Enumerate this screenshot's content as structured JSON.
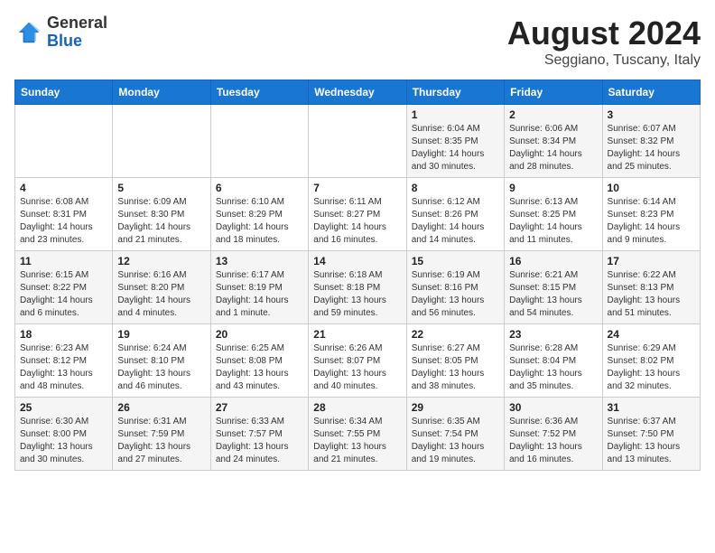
{
  "logo": {
    "general": "General",
    "blue": "Blue"
  },
  "header": {
    "month_year": "August 2024",
    "location": "Seggiano, Tuscany, Italy"
  },
  "weekdays": [
    "Sunday",
    "Monday",
    "Tuesday",
    "Wednesday",
    "Thursday",
    "Friday",
    "Saturday"
  ],
  "weeks": [
    [
      {
        "day": "",
        "info": ""
      },
      {
        "day": "",
        "info": ""
      },
      {
        "day": "",
        "info": ""
      },
      {
        "day": "",
        "info": ""
      },
      {
        "day": "1",
        "info": "Sunrise: 6:04 AM\nSunset: 8:35 PM\nDaylight: 14 hours\nand 30 minutes."
      },
      {
        "day": "2",
        "info": "Sunrise: 6:06 AM\nSunset: 8:34 PM\nDaylight: 14 hours\nand 28 minutes."
      },
      {
        "day": "3",
        "info": "Sunrise: 6:07 AM\nSunset: 8:32 PM\nDaylight: 14 hours\nand 25 minutes."
      }
    ],
    [
      {
        "day": "4",
        "info": "Sunrise: 6:08 AM\nSunset: 8:31 PM\nDaylight: 14 hours\nand 23 minutes."
      },
      {
        "day": "5",
        "info": "Sunrise: 6:09 AM\nSunset: 8:30 PM\nDaylight: 14 hours\nand 21 minutes."
      },
      {
        "day": "6",
        "info": "Sunrise: 6:10 AM\nSunset: 8:29 PM\nDaylight: 14 hours\nand 18 minutes."
      },
      {
        "day": "7",
        "info": "Sunrise: 6:11 AM\nSunset: 8:27 PM\nDaylight: 14 hours\nand 16 minutes."
      },
      {
        "day": "8",
        "info": "Sunrise: 6:12 AM\nSunset: 8:26 PM\nDaylight: 14 hours\nand 14 minutes."
      },
      {
        "day": "9",
        "info": "Sunrise: 6:13 AM\nSunset: 8:25 PM\nDaylight: 14 hours\nand 11 minutes."
      },
      {
        "day": "10",
        "info": "Sunrise: 6:14 AM\nSunset: 8:23 PM\nDaylight: 14 hours\nand 9 minutes."
      }
    ],
    [
      {
        "day": "11",
        "info": "Sunrise: 6:15 AM\nSunset: 8:22 PM\nDaylight: 14 hours\nand 6 minutes."
      },
      {
        "day": "12",
        "info": "Sunrise: 6:16 AM\nSunset: 8:20 PM\nDaylight: 14 hours\nand 4 minutes."
      },
      {
        "day": "13",
        "info": "Sunrise: 6:17 AM\nSunset: 8:19 PM\nDaylight: 14 hours\nand 1 minute."
      },
      {
        "day": "14",
        "info": "Sunrise: 6:18 AM\nSunset: 8:18 PM\nDaylight: 13 hours\nand 59 minutes."
      },
      {
        "day": "15",
        "info": "Sunrise: 6:19 AM\nSunset: 8:16 PM\nDaylight: 13 hours\nand 56 minutes."
      },
      {
        "day": "16",
        "info": "Sunrise: 6:21 AM\nSunset: 8:15 PM\nDaylight: 13 hours\nand 54 minutes."
      },
      {
        "day": "17",
        "info": "Sunrise: 6:22 AM\nSunset: 8:13 PM\nDaylight: 13 hours\nand 51 minutes."
      }
    ],
    [
      {
        "day": "18",
        "info": "Sunrise: 6:23 AM\nSunset: 8:12 PM\nDaylight: 13 hours\nand 48 minutes."
      },
      {
        "day": "19",
        "info": "Sunrise: 6:24 AM\nSunset: 8:10 PM\nDaylight: 13 hours\nand 46 minutes."
      },
      {
        "day": "20",
        "info": "Sunrise: 6:25 AM\nSunset: 8:08 PM\nDaylight: 13 hours\nand 43 minutes."
      },
      {
        "day": "21",
        "info": "Sunrise: 6:26 AM\nSunset: 8:07 PM\nDaylight: 13 hours\nand 40 minutes."
      },
      {
        "day": "22",
        "info": "Sunrise: 6:27 AM\nSunset: 8:05 PM\nDaylight: 13 hours\nand 38 minutes."
      },
      {
        "day": "23",
        "info": "Sunrise: 6:28 AM\nSunset: 8:04 PM\nDaylight: 13 hours\nand 35 minutes."
      },
      {
        "day": "24",
        "info": "Sunrise: 6:29 AM\nSunset: 8:02 PM\nDaylight: 13 hours\nand 32 minutes."
      }
    ],
    [
      {
        "day": "25",
        "info": "Sunrise: 6:30 AM\nSunset: 8:00 PM\nDaylight: 13 hours\nand 30 minutes."
      },
      {
        "day": "26",
        "info": "Sunrise: 6:31 AM\nSunset: 7:59 PM\nDaylight: 13 hours\nand 27 minutes."
      },
      {
        "day": "27",
        "info": "Sunrise: 6:33 AM\nSunset: 7:57 PM\nDaylight: 13 hours\nand 24 minutes."
      },
      {
        "day": "28",
        "info": "Sunrise: 6:34 AM\nSunset: 7:55 PM\nDaylight: 13 hours\nand 21 minutes."
      },
      {
        "day": "29",
        "info": "Sunrise: 6:35 AM\nSunset: 7:54 PM\nDaylight: 13 hours\nand 19 minutes."
      },
      {
        "day": "30",
        "info": "Sunrise: 6:36 AM\nSunset: 7:52 PM\nDaylight: 13 hours\nand 16 minutes."
      },
      {
        "day": "31",
        "info": "Sunrise: 6:37 AM\nSunset: 7:50 PM\nDaylight: 13 hours\nand 13 minutes."
      }
    ]
  ]
}
